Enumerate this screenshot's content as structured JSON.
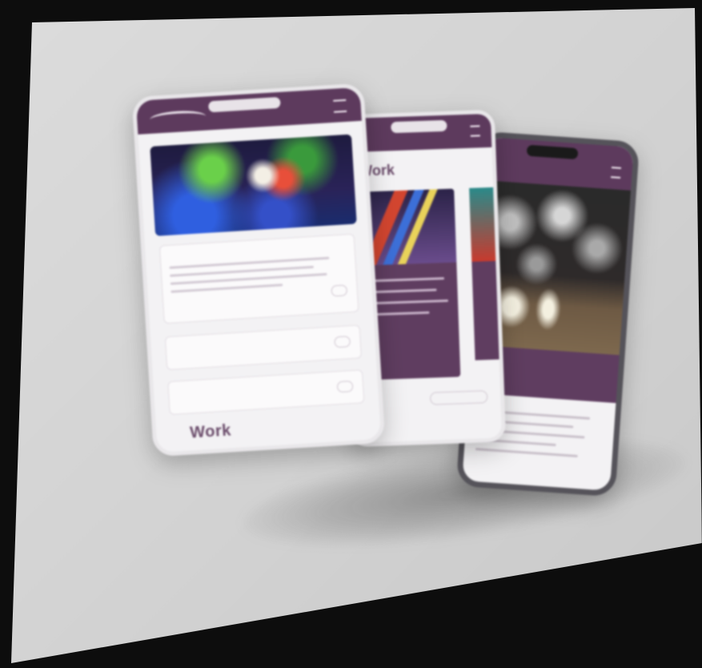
{
  "phone_front": {
    "card_title": "",
    "item_1": "",
    "item_2": "",
    "section_title": "Work"
  },
  "phone_middle": {
    "heading": "Work"
  },
  "colors": {
    "accent": "#5d3a5d",
    "background": "#d8d8d8",
    "frame": "#0d0d0d"
  }
}
